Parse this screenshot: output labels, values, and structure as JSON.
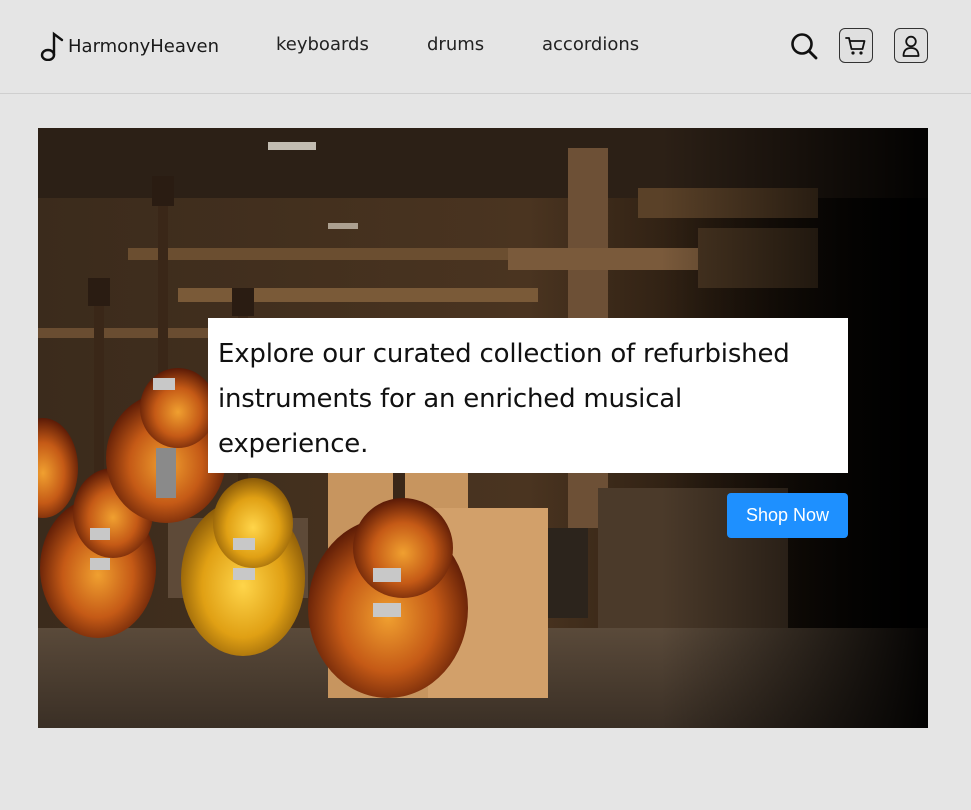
{
  "brand": {
    "name": "HarmonyHeaven",
    "icon": "music-note-icon"
  },
  "nav": {
    "links": [
      {
        "label": "keyboards"
      },
      {
        "label": "drums"
      },
      {
        "label": "accordions"
      }
    ]
  },
  "header_actions": {
    "search_icon": "search-icon",
    "cart_icon": "cart-icon",
    "user_icon": "user-icon"
  },
  "hero": {
    "image": "guitars-workshop-photo",
    "headline": "Explore our curated collection of refurbished instruments for an enriched musical experience.",
    "cta_label": "Shop Now"
  },
  "colors": {
    "background": "#e5e5e5",
    "accent": "#1e90ff",
    "text": "#1a1a1a"
  }
}
